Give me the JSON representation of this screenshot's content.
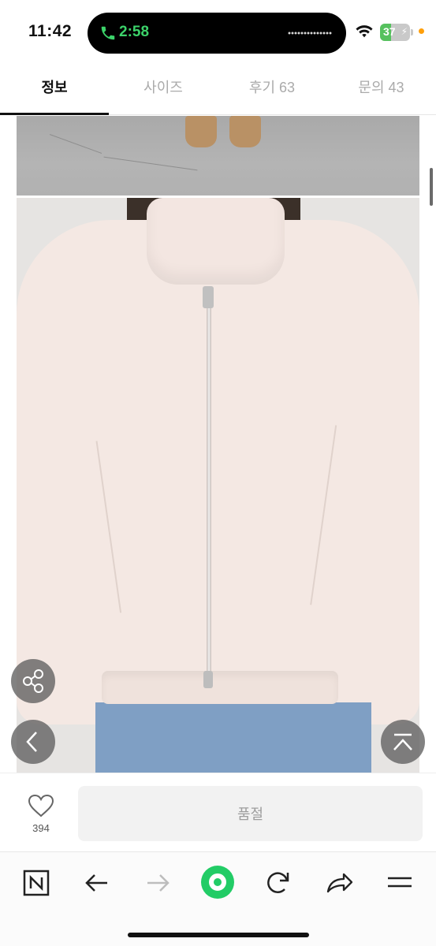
{
  "status_bar": {
    "time": "11:42",
    "call_duration": "2:58",
    "battery_level": "37",
    "battery_fraction": 0.37,
    "icons": [
      "phone-icon",
      "wifi-icon",
      "battery-icon",
      "charging-bolt-icon"
    ]
  },
  "tabs": [
    {
      "label": "정보",
      "active": true
    },
    {
      "label": "사이즈",
      "active": false
    },
    {
      "label": "후기 63",
      "active": false
    },
    {
      "label": "문의 43",
      "active": false
    }
  ],
  "floating_buttons": {
    "share": "share-icon",
    "back": "chevron-left-icon",
    "top": "scroll-to-top-icon"
  },
  "action_bar": {
    "like_count": "394",
    "like_icon": "heart-outline-icon",
    "soldout_label": "품절"
  },
  "toolbar": {
    "items": [
      "naver-n-icon",
      "arrow-left-icon",
      "arrow-right-icon",
      "green-dot-icon",
      "refresh-icon",
      "share-arrow-icon",
      "menu-icon"
    ]
  },
  "colors": {
    "accent_green": "#22cc66",
    "call_green": "#3cd36a",
    "battery_green": "#56c15e"
  }
}
